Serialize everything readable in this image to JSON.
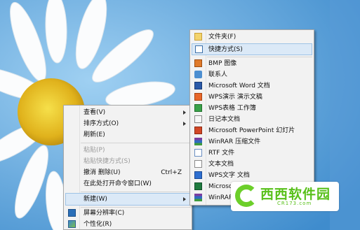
{
  "context_menu": {
    "items": [
      {
        "label": "查看(V)"
      },
      {
        "label": "排序方式(O)"
      },
      {
        "label": "刷新(E)"
      },
      {
        "label": "粘贴(P)"
      },
      {
        "label": "粘贴快捷方式(S)"
      },
      {
        "label": "撤消 删除(U)",
        "accel": "Ctrl+Z"
      },
      {
        "label": "在此处打开命令窗口(W)"
      },
      {
        "label": "新建(W)"
      },
      {
        "label": "屏幕分辨率(C)"
      },
      {
        "label": "个性化(R)"
      }
    ]
  },
  "new_submenu": {
    "items": [
      {
        "label": "文件夹(F)",
        "icon": "folder-icon"
      },
      {
        "label": "快捷方式(S)",
        "icon": "shortcut-icon"
      },
      {
        "label": "BMP 图像",
        "icon": "bmp-image-icon"
      },
      {
        "label": "联系人",
        "icon": "contact-icon"
      },
      {
        "label": "Microsoft Word 文档",
        "icon": "word-document-icon"
      },
      {
        "label": "WPS演示 演示文稿",
        "icon": "wps-presentation-icon"
      },
      {
        "label": "WPS表格 工作簿",
        "icon": "wps-spreadsheet-icon"
      },
      {
        "label": "日记本文档",
        "icon": "journal-document-icon"
      },
      {
        "label": "Microsoft PowerPoint 幻灯片",
        "icon": "powerpoint-icon"
      },
      {
        "label": "WinRAR 压缩文件",
        "icon": "winrar-icon"
      },
      {
        "label": "RTF 文件",
        "icon": "rtf-file-icon"
      },
      {
        "label": "文本文档",
        "icon": "text-document-icon"
      },
      {
        "label": "WPS文字 文档",
        "icon": "wps-writer-icon"
      },
      {
        "label": "Microso",
        "icon": "excel-icon"
      },
      {
        "label": "WinRAR",
        "icon": "winrar-zip-icon"
      }
    ]
  },
  "watermark": {
    "brand": "西西软件园",
    "url": "CR173.com"
  },
  "colors": {
    "highlight": "#dbe9f7",
    "watermark_green": "#58c01a"
  }
}
